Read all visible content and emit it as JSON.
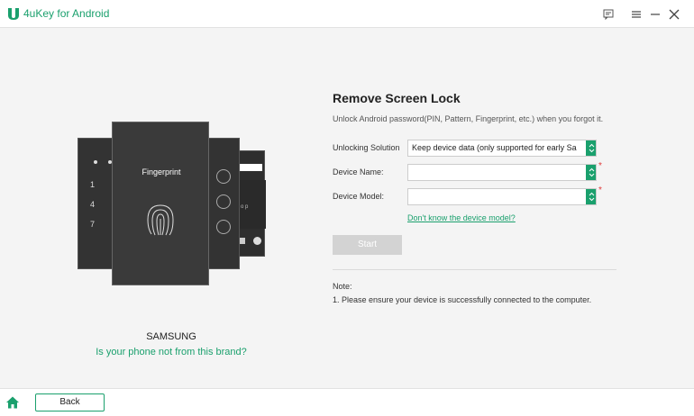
{
  "app": {
    "title": "4uKey for Android",
    "accent_color": "#1aa06d",
    "icons": [
      "feedback-icon",
      "menu-icon",
      "minimize-icon",
      "close-icon"
    ]
  },
  "illustration": {
    "front_label": "Fingerprint",
    "pin_digits": [
      "1",
      "4",
      "7"
    ],
    "keyboard_hint": "u i o p"
  },
  "device": {
    "brand": "SAMSUNG",
    "not_brand_link": "Is your phone not from this brand?"
  },
  "form": {
    "title": "Remove Screen Lock",
    "description": "Unlock Android password(PIN, Pattern, Fingerprint, etc.) when you forgot it.",
    "unlocking_solution_label": "Unlocking Solution",
    "unlocking_solution_value": "Keep device data (only supported for early Sa",
    "device_name_label": "Device Name:",
    "device_name_value": "",
    "device_model_label": "Device Model:",
    "device_model_value": "",
    "required_mark": "*",
    "model_help_link": "Don't know the device model?",
    "start_label": "Start"
  },
  "note": {
    "title": "Note:",
    "text": "1. Please ensure your device is successfully connected to the computer."
  },
  "footer": {
    "back_label": "Back"
  }
}
